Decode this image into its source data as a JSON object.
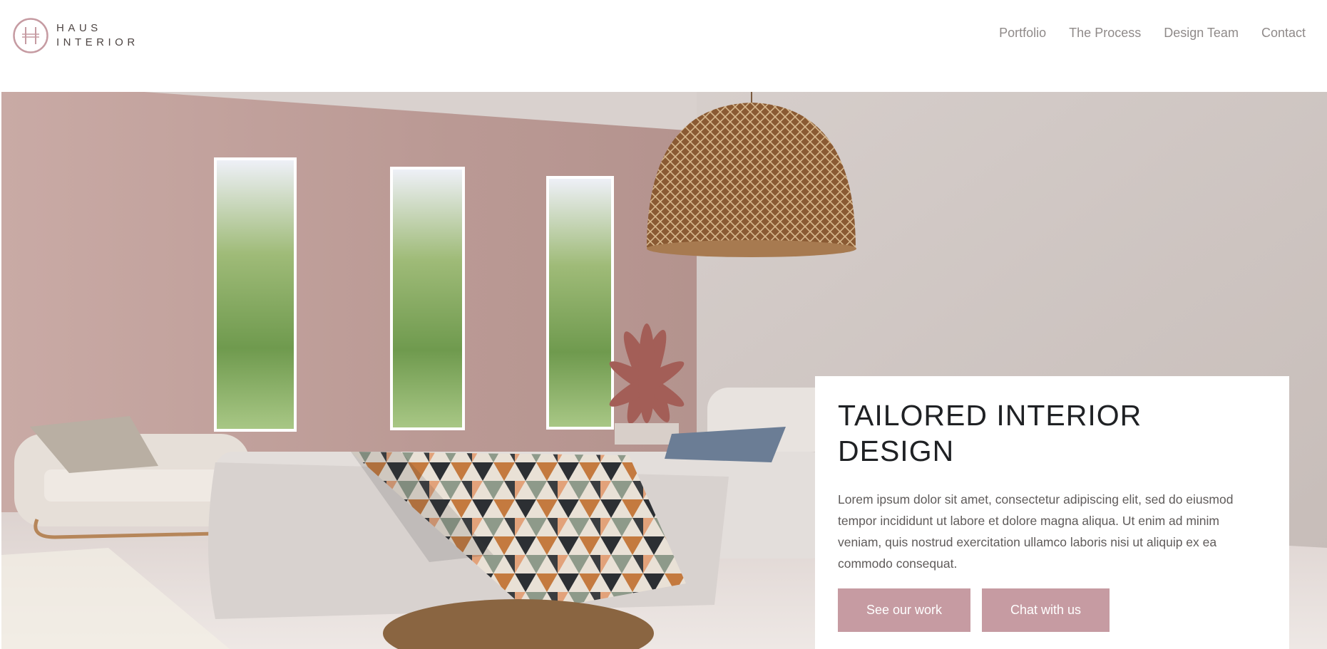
{
  "brand": {
    "line1": "HAUS",
    "line2": "INTERIOR",
    "accent_color": "#c69ba2"
  },
  "nav": {
    "items": [
      {
        "label": "Portfolio"
      },
      {
        "label": "The Process"
      },
      {
        "label": "Design Team"
      },
      {
        "label": "Contact"
      }
    ]
  },
  "hero": {
    "image": "bedroom-interior-photo",
    "card": {
      "title": "TAILORED INTERIOR DESIGN",
      "body": "Lorem ipsum dolor sit amet, consectetur adipiscing elit, sed do eiusmod tempor incididunt ut labore et dolore magna aliqua. Ut enim ad minim veniam, quis nostrud exercitation ullamco laboris nisi ut aliquip ex ea commodo consequat.",
      "primary_button": "See our work",
      "secondary_button": "Chat with us"
    }
  }
}
